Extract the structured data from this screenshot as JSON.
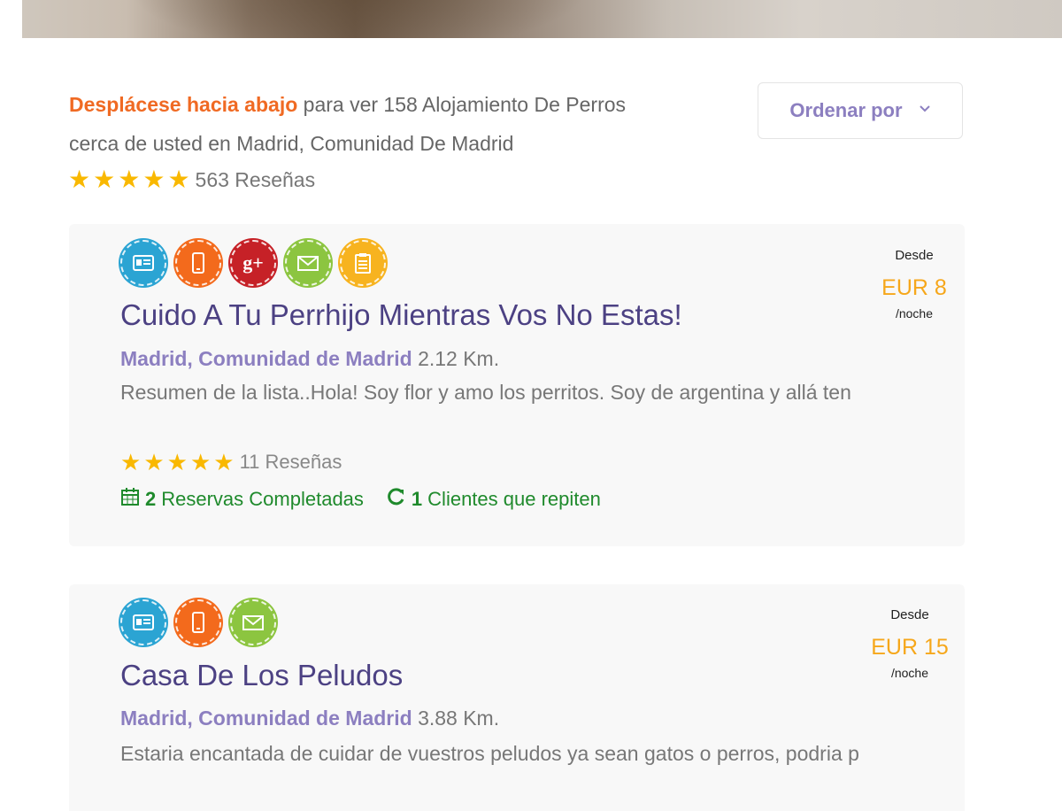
{
  "intro": {
    "highlight": "Desplácese hacia abajo",
    "text": "para ver 158 Alojamiento De Perros cerca de usted en Madrid, Comunidad De Madrid",
    "rating": 5,
    "reviews": "563 Reseñas"
  },
  "sort": {
    "label": "Ordenar por",
    "icon": "chevron-down-icon"
  },
  "listings": [
    {
      "badges": [
        "id-card-icon",
        "phone-icon",
        "google-plus-icon",
        "email-icon",
        "clipboard-icon"
      ],
      "title": "Cuido A Tu Perrhijo Mientras Vos No Estas!",
      "city": "Madrid, Comunidad de Madrid",
      "distance": "2.12 Km.",
      "description": "Resumen de la lista..Hola! Soy flor y amo los perritos. Soy de argentina y allá ten",
      "rating": 5,
      "reviews": "11 Reseñas",
      "bookings_count": "2",
      "bookings_label": "Reservas Completadas",
      "repeat_count": "1",
      "repeat_label": "Clientes que repiten",
      "price_from": "Desde",
      "price": "EUR 8",
      "price_unit": "/noche"
    },
    {
      "badges": [
        "id-card-icon",
        "phone-icon",
        "email-icon"
      ],
      "title": "Casa De Los Peludos",
      "city": "Madrid, Comunidad de Madrid",
      "distance": "3.88 Km.",
      "description": "Estaria encantada de cuidar de vuestros peludos ya sean gatos o perros, podria p",
      "price_from": "Desde",
      "price": "EUR 15",
      "price_unit": "/noche"
    }
  ],
  "colors": {
    "accent_orange": "#f06a23",
    "brand_purple": "#8c7fc0",
    "title_purple": "#4c4183",
    "price_orange": "#f6a71b",
    "star": "#f9b800",
    "success_green": "#1f8a2c",
    "badge_blue": "#2ba4d3",
    "badge_orange": "#f36a1c",
    "badge_red": "#c62127",
    "badge_green": "#8cc540",
    "badge_yellow": "#f7b31f"
  }
}
